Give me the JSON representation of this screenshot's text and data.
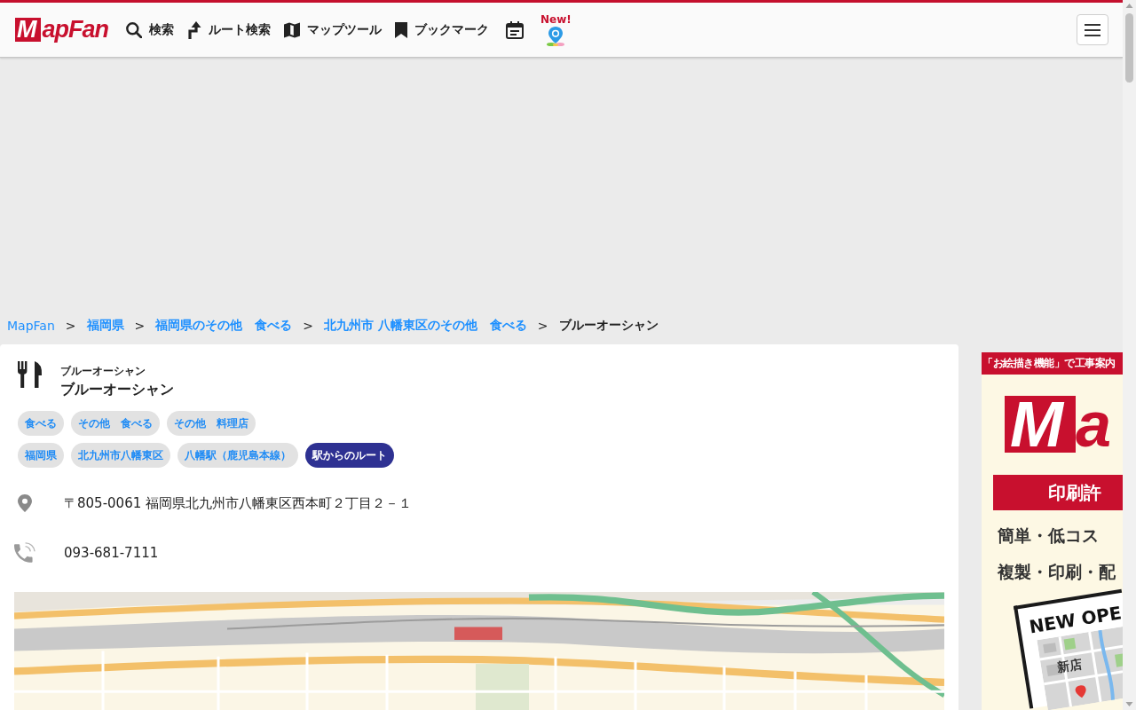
{
  "header": {
    "logo": "MapFan",
    "nav": [
      {
        "kind": "text_link",
        "label": "検索"
      },
      {
        "kind": "text_link",
        "label": "ルート検索"
      },
      {
        "kind": "text_link",
        "label": "マップツール"
      },
      {
        "kind": "text_link",
        "label": "ブックマーク"
      },
      {
        "kind": "icon_link"
      },
      {
        "kind": "icon_link",
        "badge": "New!"
      }
    ]
  },
  "breadcrumb": {
    "items": [
      {
        "label": "MapFan",
        "current": false,
        "separator": ">"
      },
      {
        "label": "福岡県",
        "current": false,
        "separator": ">"
      },
      {
        "label": "福岡県のその他　食べる",
        "current": false,
        "separator": ">"
      },
      {
        "label": "北九州市 八幡東区のその他　食べる",
        "current": false,
        "separator": ">"
      },
      {
        "label": "ブルーオーシャン",
        "current": true
      }
    ]
  },
  "place": {
    "reading": "ブルーオーシャン",
    "name": "ブルーオーシャン",
    "tag_rows": [
      [
        {
          "kind": "tag",
          "label": "食べる"
        },
        {
          "kind": "tag",
          "label": "その他　食べる"
        },
        {
          "kind": "tag",
          "label": "その他　料理店"
        }
      ],
      [
        {
          "kind": "tag",
          "label": "福岡県"
        },
        {
          "kind": "tag",
          "label": "北九州市八幡東区"
        },
        {
          "kind": "tag",
          "label": "八幡駅（鹿児島本線）"
        },
        {
          "kind": "button",
          "label": "駅からのルート"
        }
      ]
    ],
    "address": "〒805-0061 福岡県北九州市八幡東区西本町２丁目２－１",
    "phone": "093-681-7111"
  },
  "side_ad": {
    "headline": "「お絵描き機能」で工事案内",
    "logo": "Ma",
    "ribbon": "印刷許",
    "lines": [
      "簡単・低コス",
      "複製・印刷・配"
    ],
    "flyer_title": "NEW OPE",
    "flyer_label": "新店"
  }
}
